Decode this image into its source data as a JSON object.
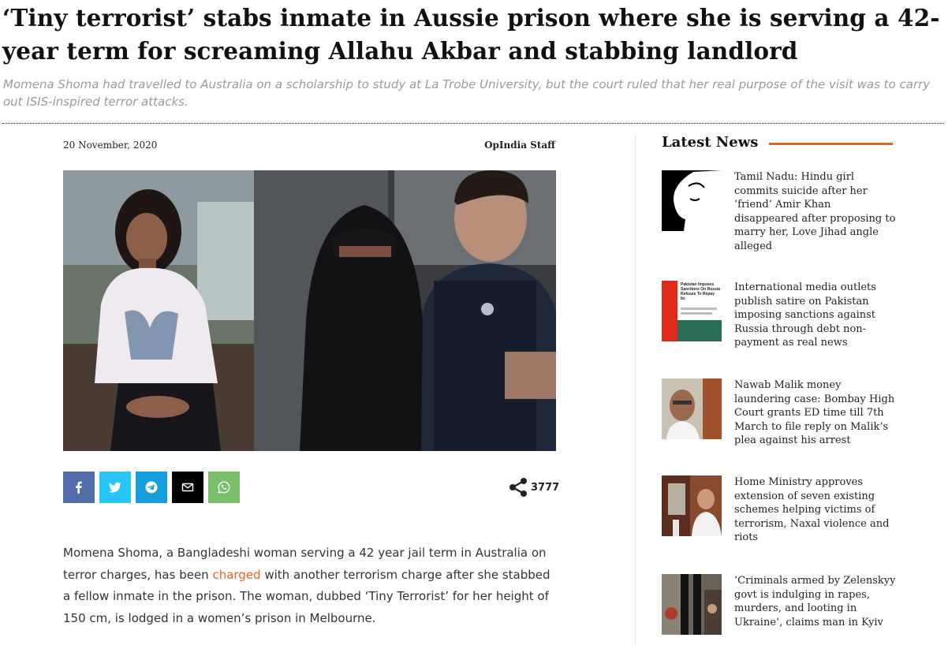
{
  "article": {
    "headline": "‘Tiny terrorist’ stabs inmate in Aussie prison where she is serving a 42-year term for screaming Allahu Akbar and stabbing landlord",
    "subtitle": "Momena Shoma had travelled to Australia on a scholarship to study at La Trobe University, but the court ruled that her real purpose of the visit was to carry out ISIS-inspired terror attacks.",
    "date": "20 November, 2020",
    "author": "OpIndia Staff",
    "share_count": "3777",
    "body_before_link": "Momena Shoma, a Bangladeshi woman serving a 42 year jail term in Australia on terror charges, has been ",
    "body_link": "charged",
    "body_after_link": " with another terrorism charge after she stabbed a fellow inmate in the prison. The woman, dubbed ‘Tiny Terrorist’ for her height of 150 cm, is lodged in a women’s prison in Melbourne."
  },
  "share_buttons": [
    {
      "icon": "facebook-icon",
      "color": "#516eab"
    },
    {
      "icon": "twitter-icon",
      "color": "#29c5f6"
    },
    {
      "icon": "telegram-icon",
      "color": "#179cde"
    },
    {
      "icon": "mail-icon",
      "color": "#000000"
    },
    {
      "icon": "whatsapp-icon",
      "color": "#7bbf6a"
    }
  ],
  "sidebar": {
    "title": "Latest News",
    "items": [
      {
        "title": "Tamil Nadu: Hindu girl commits suicide after her ‘friend’ Amir Khan disappeared after proposing to marry her, Love Jihad angle alleged"
      },
      {
        "title": "International media outlets publish satire on Pakistan imposing sanctions against Russia through debt non-payment as real news",
        "thumb_text": "Pakistan Imposes Sanctions On Russia Refuses To Repay Its"
      },
      {
        "title": "Nawab Malik money laundering case: Bombay High Court grants ED time till 7th March to file reply on Malik’s plea against his arrest"
      },
      {
        "title": "Home Ministry approves extension of seven existing schemes helping victims of terrorism, Naxal violence and riots"
      },
      {
        "title": "‘Criminals armed by Zelenskyy govt is indulging in rapes, murders, and looting in Ukraine’, claims man in Kyiv"
      }
    ]
  },
  "colors": {
    "accent": "#e8631f"
  }
}
